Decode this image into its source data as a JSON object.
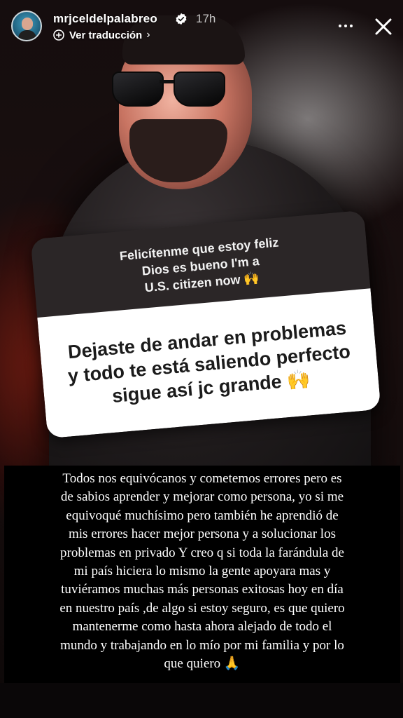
{
  "header": {
    "username": "mrjceldelpalabreo",
    "time": "17h",
    "translate_label": "Ver traducción",
    "chevron": "›",
    "icons": [
      "avatar",
      "verified-badge-icon",
      "translate-icon",
      "more-icon",
      "close-icon"
    ]
  },
  "sticker": {
    "question_lines": [
      "Felicítenme que estoy feliz",
      "Dios es bueno I'm a",
      "U.S. citizen  now 🙌"
    ],
    "answer_lines": [
      "Dejaste de andar en problemas",
      "y todo te está saliendo perfecto",
      "sigue así jc grande 🙌"
    ]
  },
  "caption": {
    "lines": [
      "Todos nos equivócanos  y cometemos errores pero es",
      "de sabios aprender  y mejorar como persona, yo si me",
      "equivoqué muchísimo pero también he aprendió de",
      "mis errores hacer mejor persona y a solucionar los",
      "problemas en privado Y creo q si toda la farándula de",
      "mi país hiciera lo mismo la gente apoyara mas y",
      "tuviéramos muchas más  personas exitosas  hoy en día",
      "en nuestro país ,de algo si estoy seguro, es que quiero",
      "mantenerme como hasta ahora alejado de todo el",
      "mundo y trabajando en lo mío por mi familia  y por lo",
      "que quiero 🙏"
    ]
  },
  "colors": {
    "question_bg": "#2b2627",
    "answer_bg": "#ffffff",
    "caption_bg": "#000000"
  }
}
